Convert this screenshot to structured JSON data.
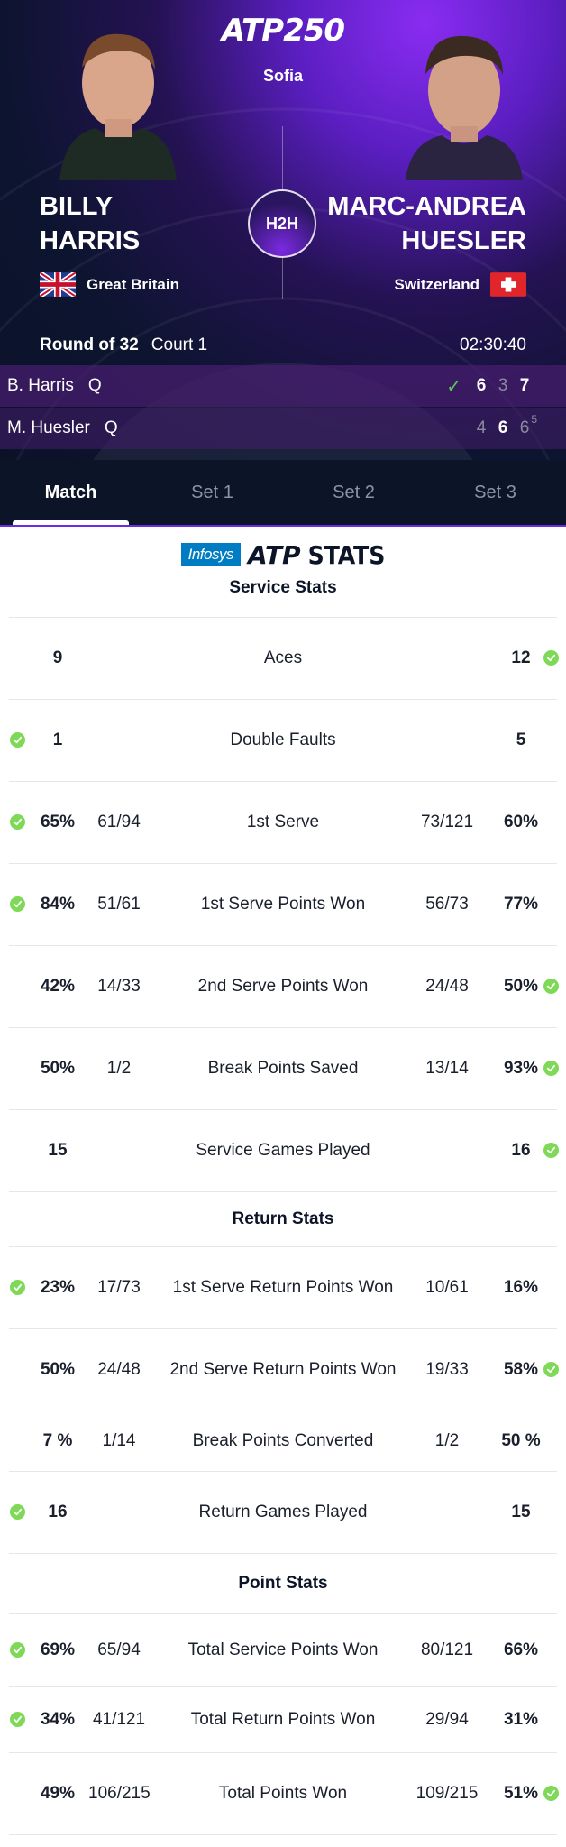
{
  "header": {
    "logo": "ATP250",
    "city": "Sofia",
    "h2h": "H2H",
    "round": "Round of 32",
    "court": "Court 1",
    "duration": "02:30:40"
  },
  "players": {
    "left": {
      "first": "BILLY",
      "last": "HARRIS",
      "country": "Great Britain"
    },
    "right": {
      "first": "MARC-ANDREA",
      "last": "HUESLER",
      "country": "Switzerland"
    }
  },
  "score": {
    "p1": {
      "name": "B. Harris",
      "seed": "Q",
      "sets": [
        "6",
        "3",
        "7"
      ]
    },
    "p2": {
      "name": "M. Huesler",
      "seed": "Q",
      "sets": [
        "4",
        "6",
        "6"
      ],
      "tiebreak": "5"
    }
  },
  "tabs": [
    "Match",
    "Set 1",
    "Set 2",
    "Set 3"
  ],
  "sponsor": {
    "infosys": "Infosys",
    "atp": "ATP",
    "stats": "STATS"
  },
  "sections": {
    "service": "Service Stats",
    "return": "Return Stats",
    "point": "Point Stats"
  },
  "service_stats": [
    {
      "label": "Aces",
      "lp": "9",
      "lf": "",
      "rf": "",
      "rp": "12",
      "win": "right"
    },
    {
      "label": "Double Faults",
      "lp": "1",
      "lf": "",
      "rf": "",
      "rp": "5",
      "win": "left"
    },
    {
      "label": "1st Serve",
      "lp": "65%",
      "lf": "61/94",
      "rf": "73/121",
      "rp": "60%",
      "win": "left"
    },
    {
      "label": "1st Serve Points Won",
      "lp": "84%",
      "lf": "51/61",
      "rf": "56/73",
      "rp": "77%",
      "win": "left"
    },
    {
      "label": "2nd Serve Points Won",
      "lp": "42%",
      "lf": "14/33",
      "rf": "24/48",
      "rp": "50%",
      "win": "right"
    },
    {
      "label": "Break Points Saved",
      "lp": "50%",
      "lf": "1/2",
      "rf": "13/14",
      "rp": "93%",
      "win": "right"
    },
    {
      "label": "Service Games Played",
      "lp": "15",
      "lf": "",
      "rf": "",
      "rp": "16",
      "win": "right"
    }
  ],
  "return_stats": [
    {
      "label": "1st Serve Return Points Won",
      "lp": "23%",
      "lf": "17/73",
      "rf": "10/61",
      "rp": "16%",
      "win": "left"
    },
    {
      "label": "2nd Serve Return Points Won",
      "lp": "50%",
      "lf": "24/48",
      "rf": "19/33",
      "rp": "58%",
      "win": "right"
    },
    {
      "label": "Break Points Converted",
      "lp": "7 %",
      "lf": "1/14",
      "rf": "1/2",
      "rp": "50 %",
      "win": "none"
    },
    {
      "label": "Return Games Played",
      "lp": "16",
      "lf": "",
      "rf": "",
      "rp": "15",
      "win": "left"
    }
  ],
  "point_stats": [
    {
      "label": "Total Service Points Won",
      "lp": "69%",
      "lf": "65/94",
      "rf": "80/121",
      "rp": "66%",
      "win": "left"
    },
    {
      "label": "Total Return Points Won",
      "lp": "34%",
      "lf": "41/121",
      "rf": "29/94",
      "rp": "31%",
      "win": "left"
    },
    {
      "label": "Total Points Won",
      "lp": "49%",
      "lf": "106/215",
      "rf": "109/215",
      "rp": "51%",
      "win": "right"
    }
  ],
  "colors": {
    "accent": "#6a2ce0",
    "check": "#7ed957",
    "navy": "#0c1428"
  }
}
